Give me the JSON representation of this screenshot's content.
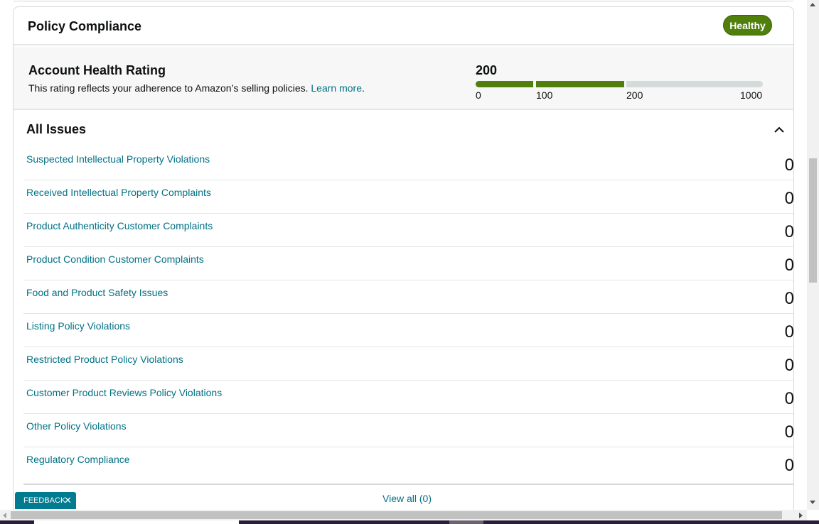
{
  "header": {
    "title": "Policy Compliance",
    "status_badge": "Healthy"
  },
  "account_health": {
    "title": "Account Health Rating",
    "description": "This rating reflects your adherence to Amazon’s selling policies. ",
    "learn_more": "Learn more",
    "trailing_period": ".",
    "score": "200",
    "scale_ticks": [
      "0",
      "100",
      "200",
      "1000"
    ],
    "score_fraction_of_bar": 0.5,
    "colors": {
      "healthy": "#507f0c",
      "track": "#d5dbdb"
    }
  },
  "issues": {
    "title": "All Issues",
    "items": [
      {
        "label": "Suspected Intellectual Property Violations",
        "count": "0"
      },
      {
        "label": "Received Intellectual Property Complaints",
        "count": "0"
      },
      {
        "label": "Product Authenticity Customer Complaints",
        "count": "0"
      },
      {
        "label": "Product Condition Customer Complaints",
        "count": "0"
      },
      {
        "label": "Food and Product Safety Issues",
        "count": "0"
      },
      {
        "label": "Listing Policy Violations",
        "count": "0"
      },
      {
        "label": "Restricted Product Policy Violations",
        "count": "0"
      },
      {
        "label": "Customer Product Reviews Policy Violations",
        "count": "0"
      },
      {
        "label": "Other Policy Violations",
        "count": "0"
      },
      {
        "label": "Regulatory Compliance",
        "count": "0"
      }
    ],
    "view_all": "View all (0)"
  },
  "feedback": {
    "label": "FEEDBACK",
    "close": "✕"
  },
  "icons": {
    "collapse": "chevron-up-icon",
    "feedback_close": "close-icon"
  }
}
